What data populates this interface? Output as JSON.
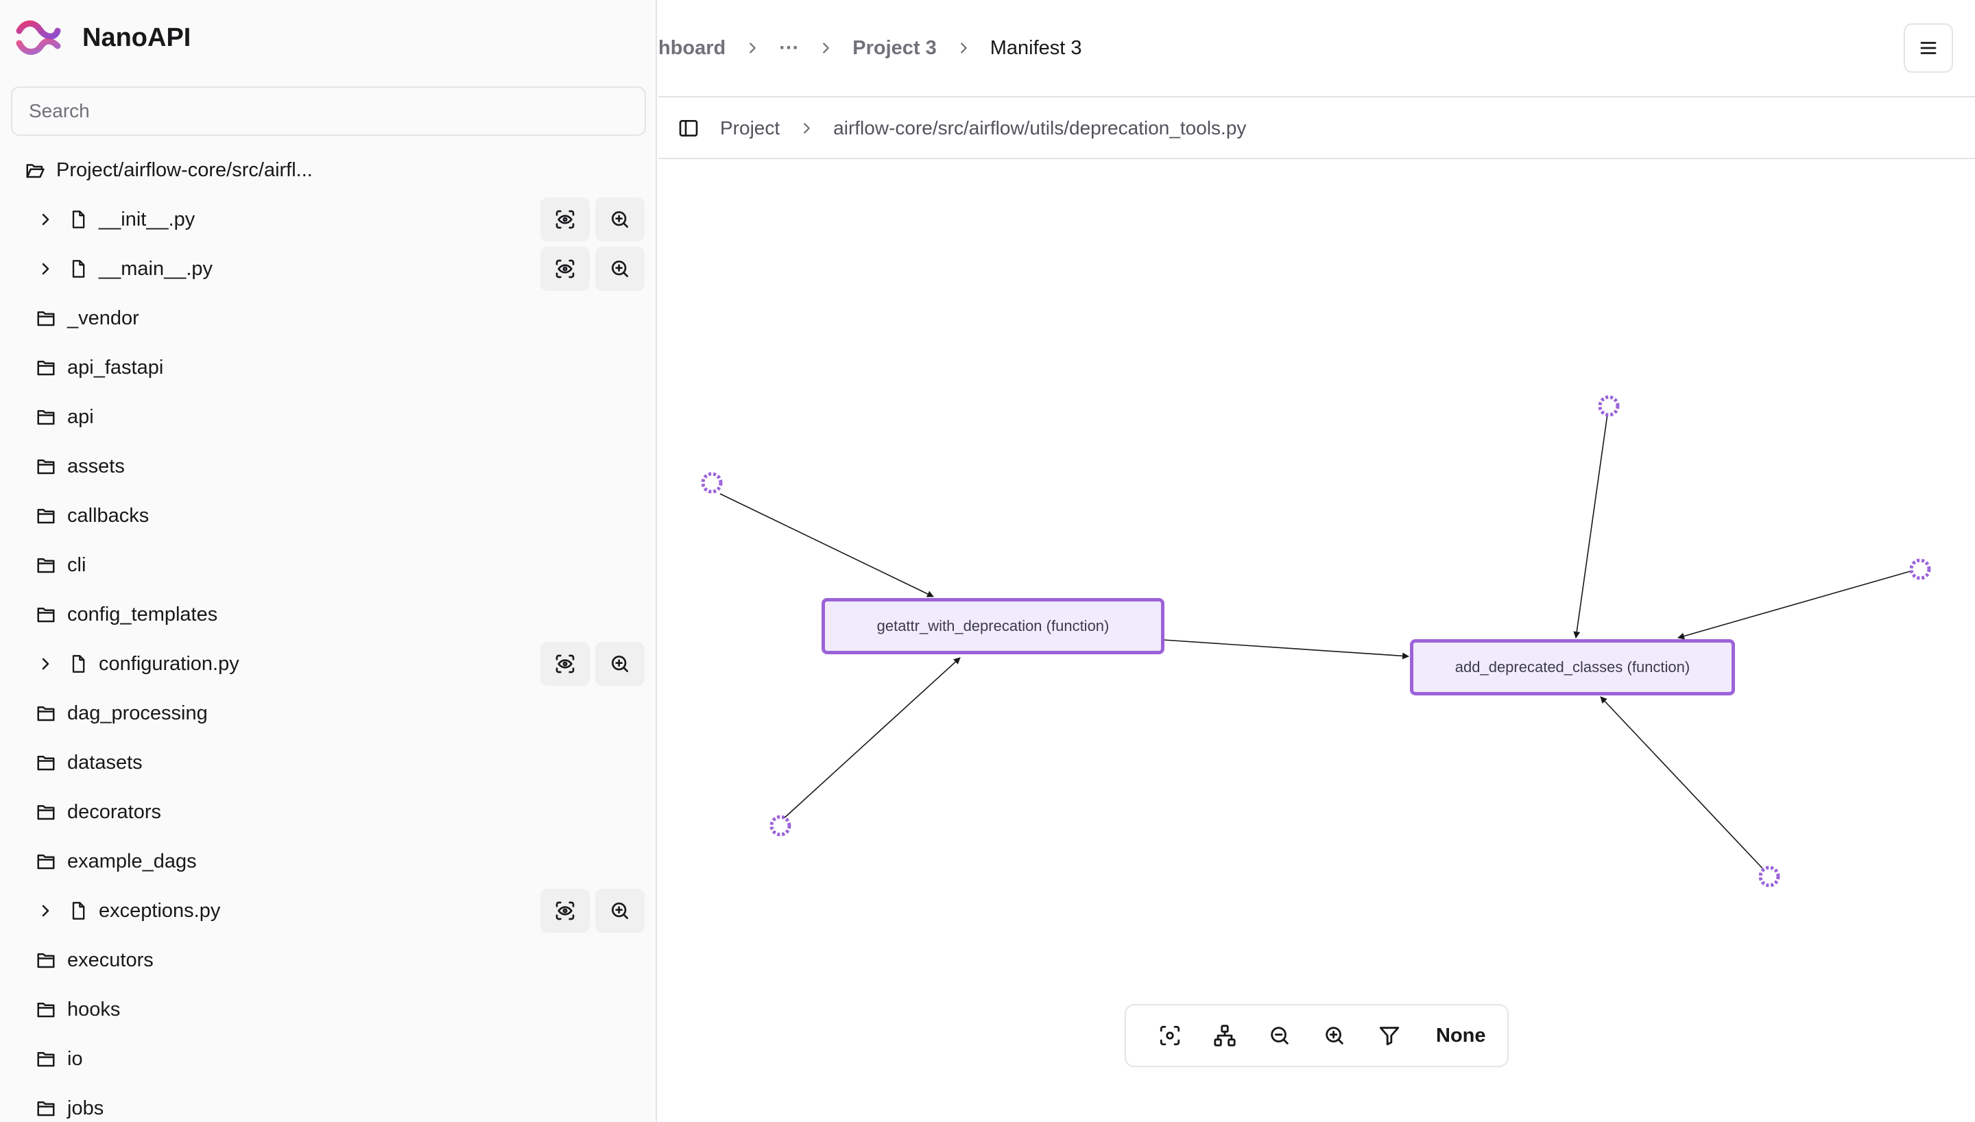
{
  "app": {
    "name": "NanoAPI"
  },
  "search": {
    "placeholder": "Search"
  },
  "tree": {
    "root": "Project/airflow-core/src/airfl...",
    "items": [
      {
        "label": "__init__.py",
        "kind": "file"
      },
      {
        "label": "__main__.py",
        "kind": "file"
      },
      {
        "label": "_vendor",
        "kind": "folder"
      },
      {
        "label": "api_fastapi",
        "kind": "folder"
      },
      {
        "label": "api",
        "kind": "folder"
      },
      {
        "label": "assets",
        "kind": "folder"
      },
      {
        "label": "callbacks",
        "kind": "folder"
      },
      {
        "label": "cli",
        "kind": "folder"
      },
      {
        "label": "config_templates",
        "kind": "folder"
      },
      {
        "label": "configuration.py",
        "kind": "file"
      },
      {
        "label": "dag_processing",
        "kind": "folder"
      },
      {
        "label": "datasets",
        "kind": "folder"
      },
      {
        "label": "decorators",
        "kind": "folder"
      },
      {
        "label": "example_dags",
        "kind": "folder"
      },
      {
        "label": "exceptions.py",
        "kind": "file"
      },
      {
        "label": "executors",
        "kind": "folder"
      },
      {
        "label": "hooks",
        "kind": "folder"
      },
      {
        "label": "io",
        "kind": "folder"
      },
      {
        "label": "jobs",
        "kind": "folder"
      }
    ]
  },
  "header": {
    "breadcrumb": {
      "dashboard": "hboard",
      "ellipsis": "···",
      "project": "Project 3",
      "manifest": "Manifest 3"
    }
  },
  "subheader": {
    "project": "Project",
    "path": "airflow-core/src/airflow/utils/deprecation_tools.py"
  },
  "graph": {
    "nodes": {
      "getattr": "getattr_with_deprecation (function)",
      "add_deprecated": "add_deprecated_classes (function)"
    }
  },
  "toolbar": {
    "filter_value": "None"
  },
  "colors": {
    "accent": "#9b62d9",
    "node_fill": "#f2ebfb",
    "brand": "#b03f9a"
  }
}
